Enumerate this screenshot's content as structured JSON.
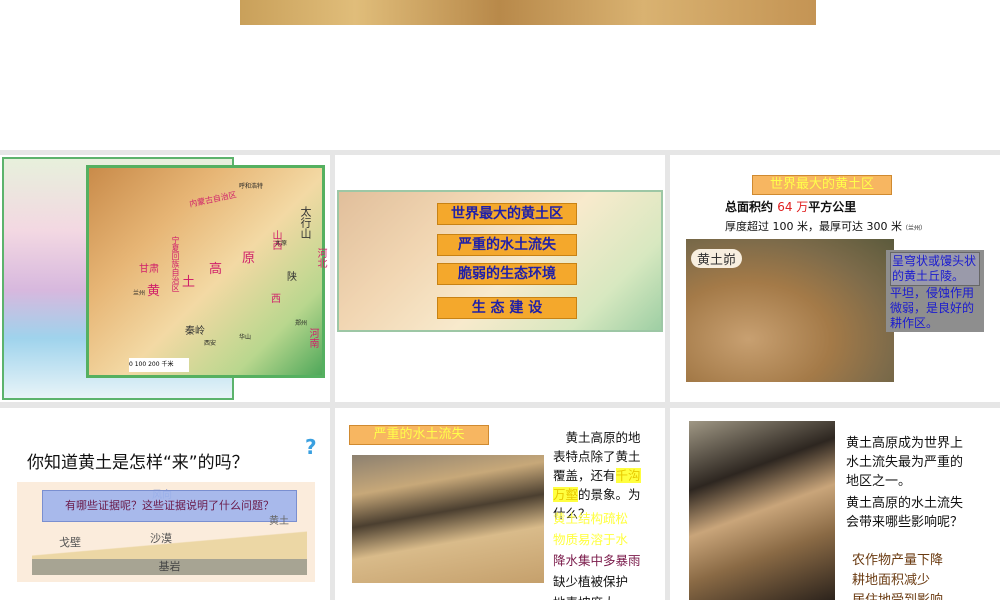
{
  "slide1": {
    "map_labels": [
      "内蒙古自治区",
      "宁夏回族自治区",
      "甘肃",
      "黄",
      "土",
      "高",
      "原",
      "山西",
      "陕",
      "西",
      "太行山",
      "河北",
      "河南",
      "秦岭",
      "兰州",
      "西安",
      "呼和浩特",
      "太原",
      "郑州",
      "华山"
    ],
    "scale": "0 100 200 千米"
  },
  "slide2": {
    "items": [
      "世界最大的黄土区",
      "严重的水土流失",
      "脆弱的生态环境",
      "生 态 建 设"
    ]
  },
  "slide3": {
    "title": "世界最大的黄土区",
    "area_prefix": "总面积约",
    "area_value": "64 万",
    "area_suffix": "平方公里",
    "thickness": "厚度超过 100 米，最厚可达 300 米",
    "thickness_note": "（兰州）",
    "photo_label": "黄土峁",
    "overlay1": "呈穹状或馒头状的黄土丘陵。",
    "overlay2": "平坦，侵蚀作用微弱，是良好的耕作区。"
  },
  "slide4": {
    "question": "你知道黄土是怎样“来”的吗？",
    "qmark": "?",
    "banner": "有哪些证据呢？这些证据说明了什么问题？",
    "labels": {
      "wind": "风向",
      "loess": "黄土",
      "gobi": "戈壁",
      "desert": "沙漠",
      "bedrock": "基岩"
    }
  },
  "slide5": {
    "title": "严重的水土流失",
    "para_a": "黄土高原的地表特点除了黄土覆盖，还有",
    "highlight": "千沟万壑",
    "para_b": "的景象。为什么？",
    "reasons": [
      {
        "text": "黄土结构疏松",
        "color": "#ffff40"
      },
      {
        "text": "物质易溶于水",
        "color": "#ffff40"
      },
      {
        "text": "降水集中多暴雨",
        "color": "#7a1a4a"
      },
      {
        "text": "缺少植被保护",
        "color": "#111111"
      },
      {
        "text": "地表坡度大",
        "color": "#111111"
      }
    ]
  },
  "slide6": {
    "p1": "黄土高原成为世界上水土流失最为严重的地区之一。",
    "p2": "黄土高原的水土流失会带来哪些影响呢？",
    "effects": [
      "农作物产量下降",
      "耕地面积减少",
      "居住地受到影响"
    ]
  }
}
